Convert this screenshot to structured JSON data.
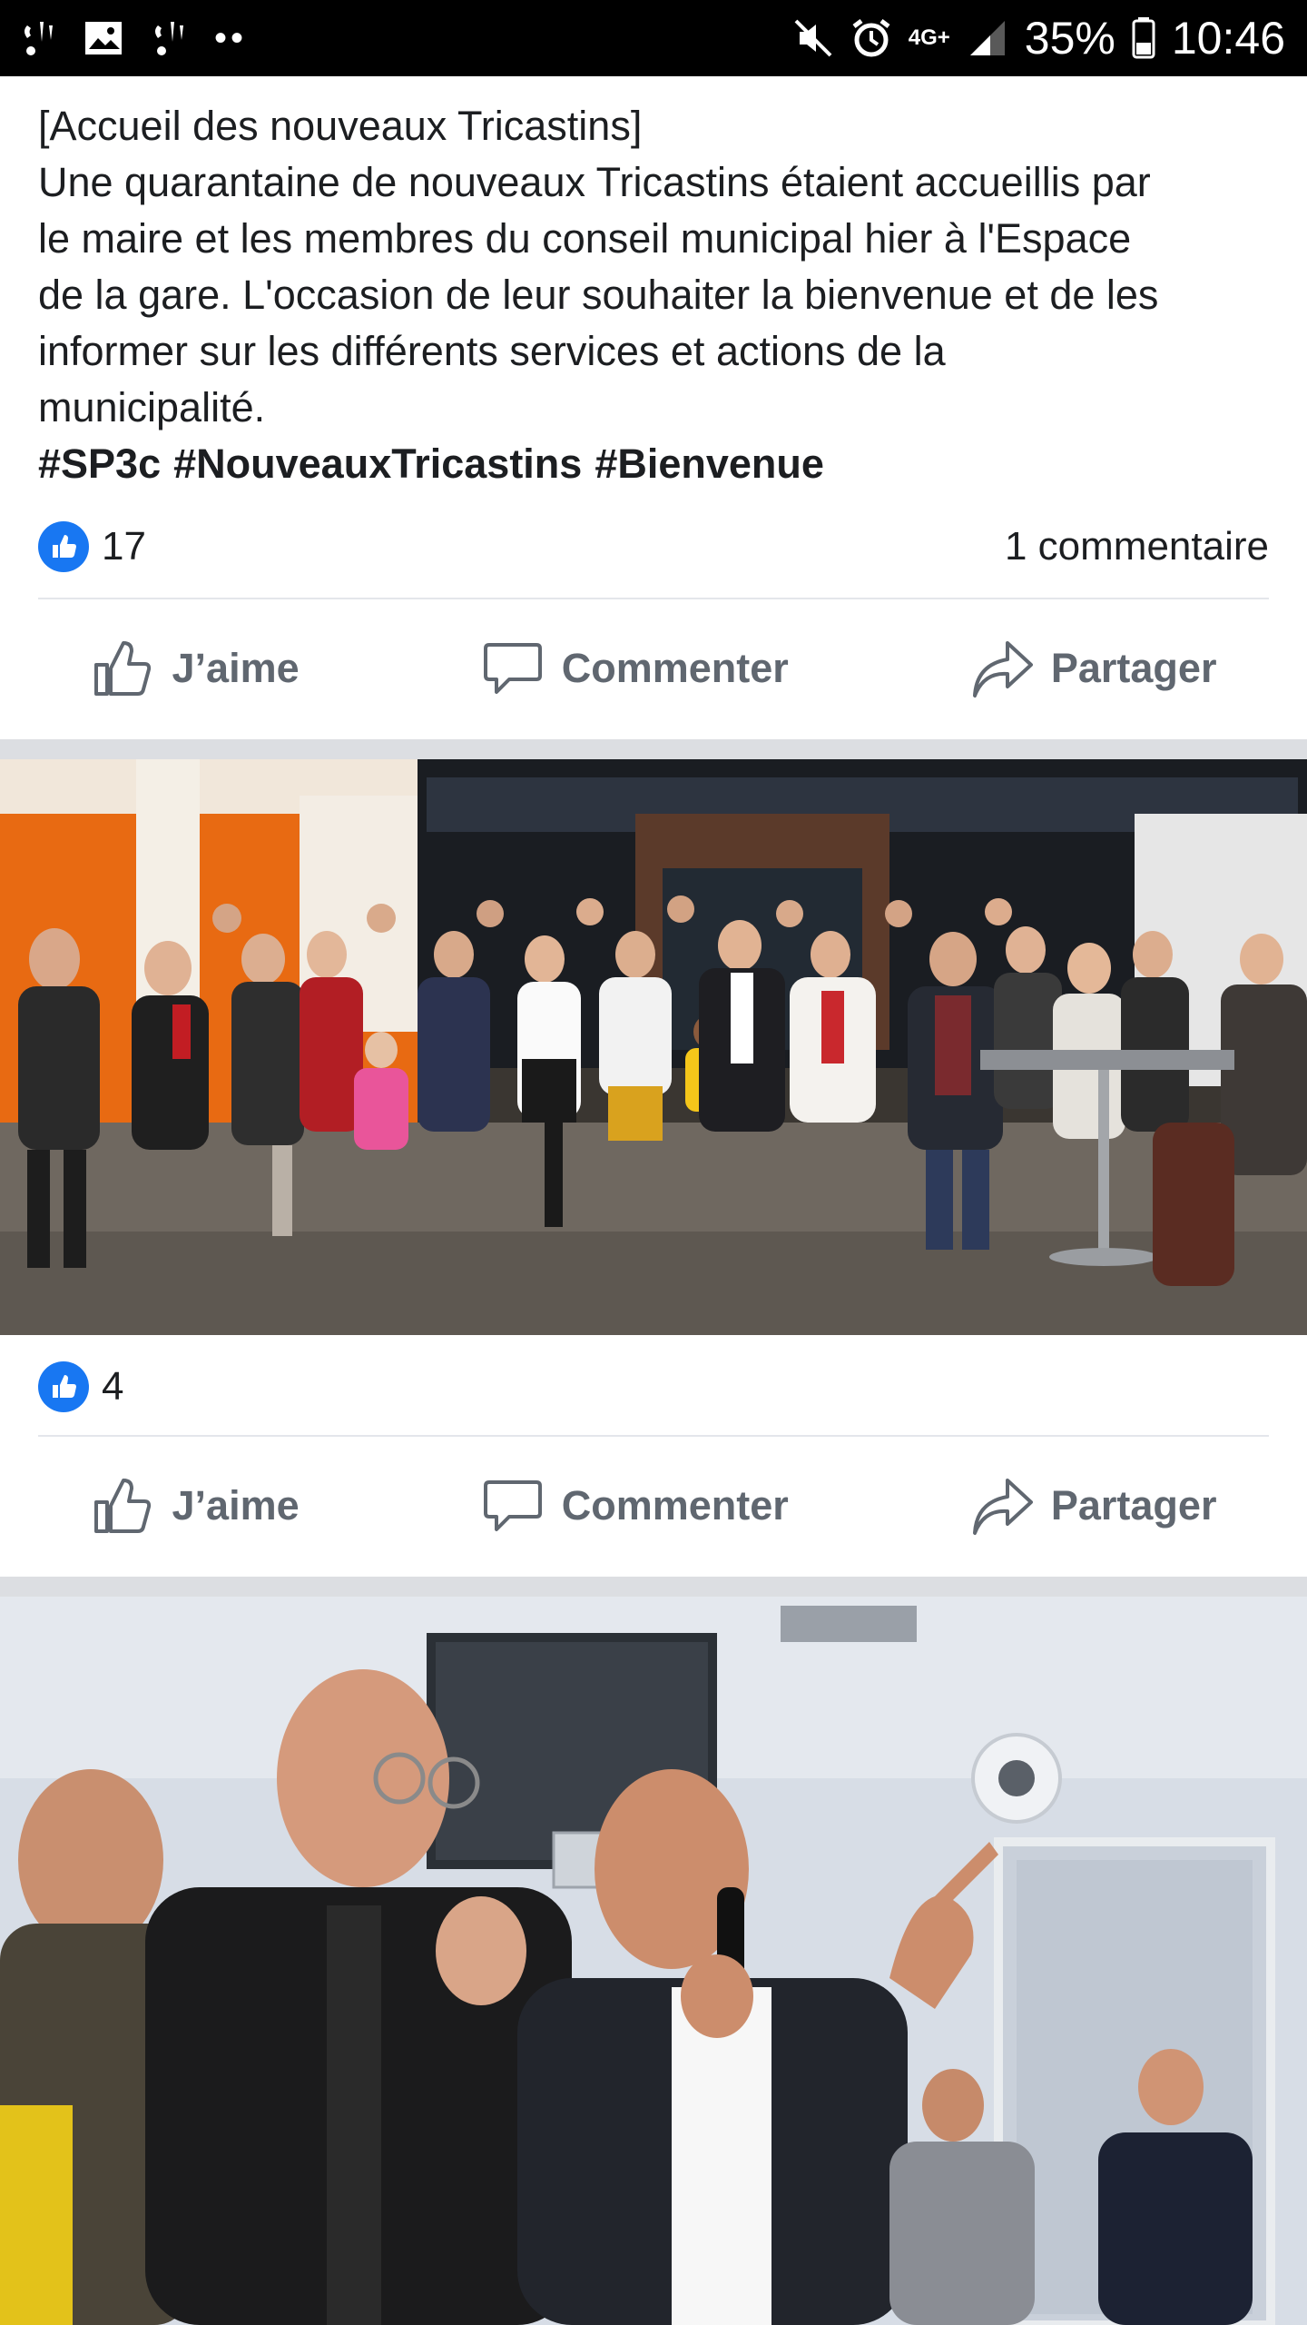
{
  "status_bar": {
    "left_icons": [
      "wifi-calling-icon",
      "image-icon",
      "wifi-calling-icon"
    ],
    "dots": "••",
    "right_icons": [
      "mute-icon",
      "alarm-icon",
      "4g-icon",
      "signal-icon",
      "battery-icon"
    ],
    "network": "4G+",
    "battery": "35%",
    "time": "10:46"
  },
  "post": {
    "lines": [
      "[Accueil des nouveaux Tricastins]",
      "Une quarantaine de nouveaux Tricastins étaient accueillis par",
      "le maire et les membres du conseil municipal hier à l'Espace",
      "de la gare. L'occasion de leur souhaiter la bienvenue et de les",
      "informer sur les différents services et actions de la",
      "municipalité."
    ],
    "hashtags": [
      "#SP3c",
      "#NouveauxTricastins",
      "#Bienvenue"
    ],
    "likes": "17",
    "comments": "1 commentaire"
  },
  "actions": {
    "like": "J’aime",
    "comment": "Commenter",
    "share": "Partager"
  },
  "photo1": {
    "likes": "4"
  },
  "colors": {
    "accent": "#1877f2",
    "action_text": "#606770",
    "separator": "#dcdee2"
  }
}
